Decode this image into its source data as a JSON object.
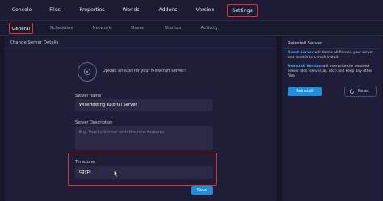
{
  "top_tabs": [
    {
      "label": "Console"
    },
    {
      "label": "Files"
    },
    {
      "label": "Properties"
    },
    {
      "label": "Worlds"
    },
    {
      "label": "Addons"
    },
    {
      "label": "Version"
    },
    {
      "label": "Settings",
      "active": true
    }
  ],
  "sub_tabs": [
    {
      "label": "General",
      "active": true
    },
    {
      "label": "Schedules"
    },
    {
      "label": "Network"
    },
    {
      "label": "Users"
    },
    {
      "label": "Startup"
    },
    {
      "label": "Activity"
    }
  ],
  "details": {
    "title": "Change Server Details",
    "upload_text": "Upload an icon for your Minecraft server!",
    "server_name_label": "Server name",
    "server_name_value": "WiseHosting Tutorial Server",
    "description_label": "Server Description",
    "description_placeholder": "E.g. Vanilla Server with the new features",
    "timezone_label": "Timezone",
    "timezone_value": "Egypt",
    "save_label": "Save"
  },
  "reinstall": {
    "title": "Reinstall Server",
    "reset_server_label": "Reset Server",
    "reset_server_text": " will delete all files on your server and reset it to a fresh install.",
    "reinstall_version_label": "Reinstall Version",
    "reinstall_version_text": " will overwrite the required server files (server.jar, etc.) and keep any other files",
    "reinstall_button": "Reinstall",
    "reset_button": "Reset"
  },
  "colors": {
    "accent_blue": "#1e8fe0",
    "highlight_red": "#e0313a",
    "background": "#16162b"
  }
}
